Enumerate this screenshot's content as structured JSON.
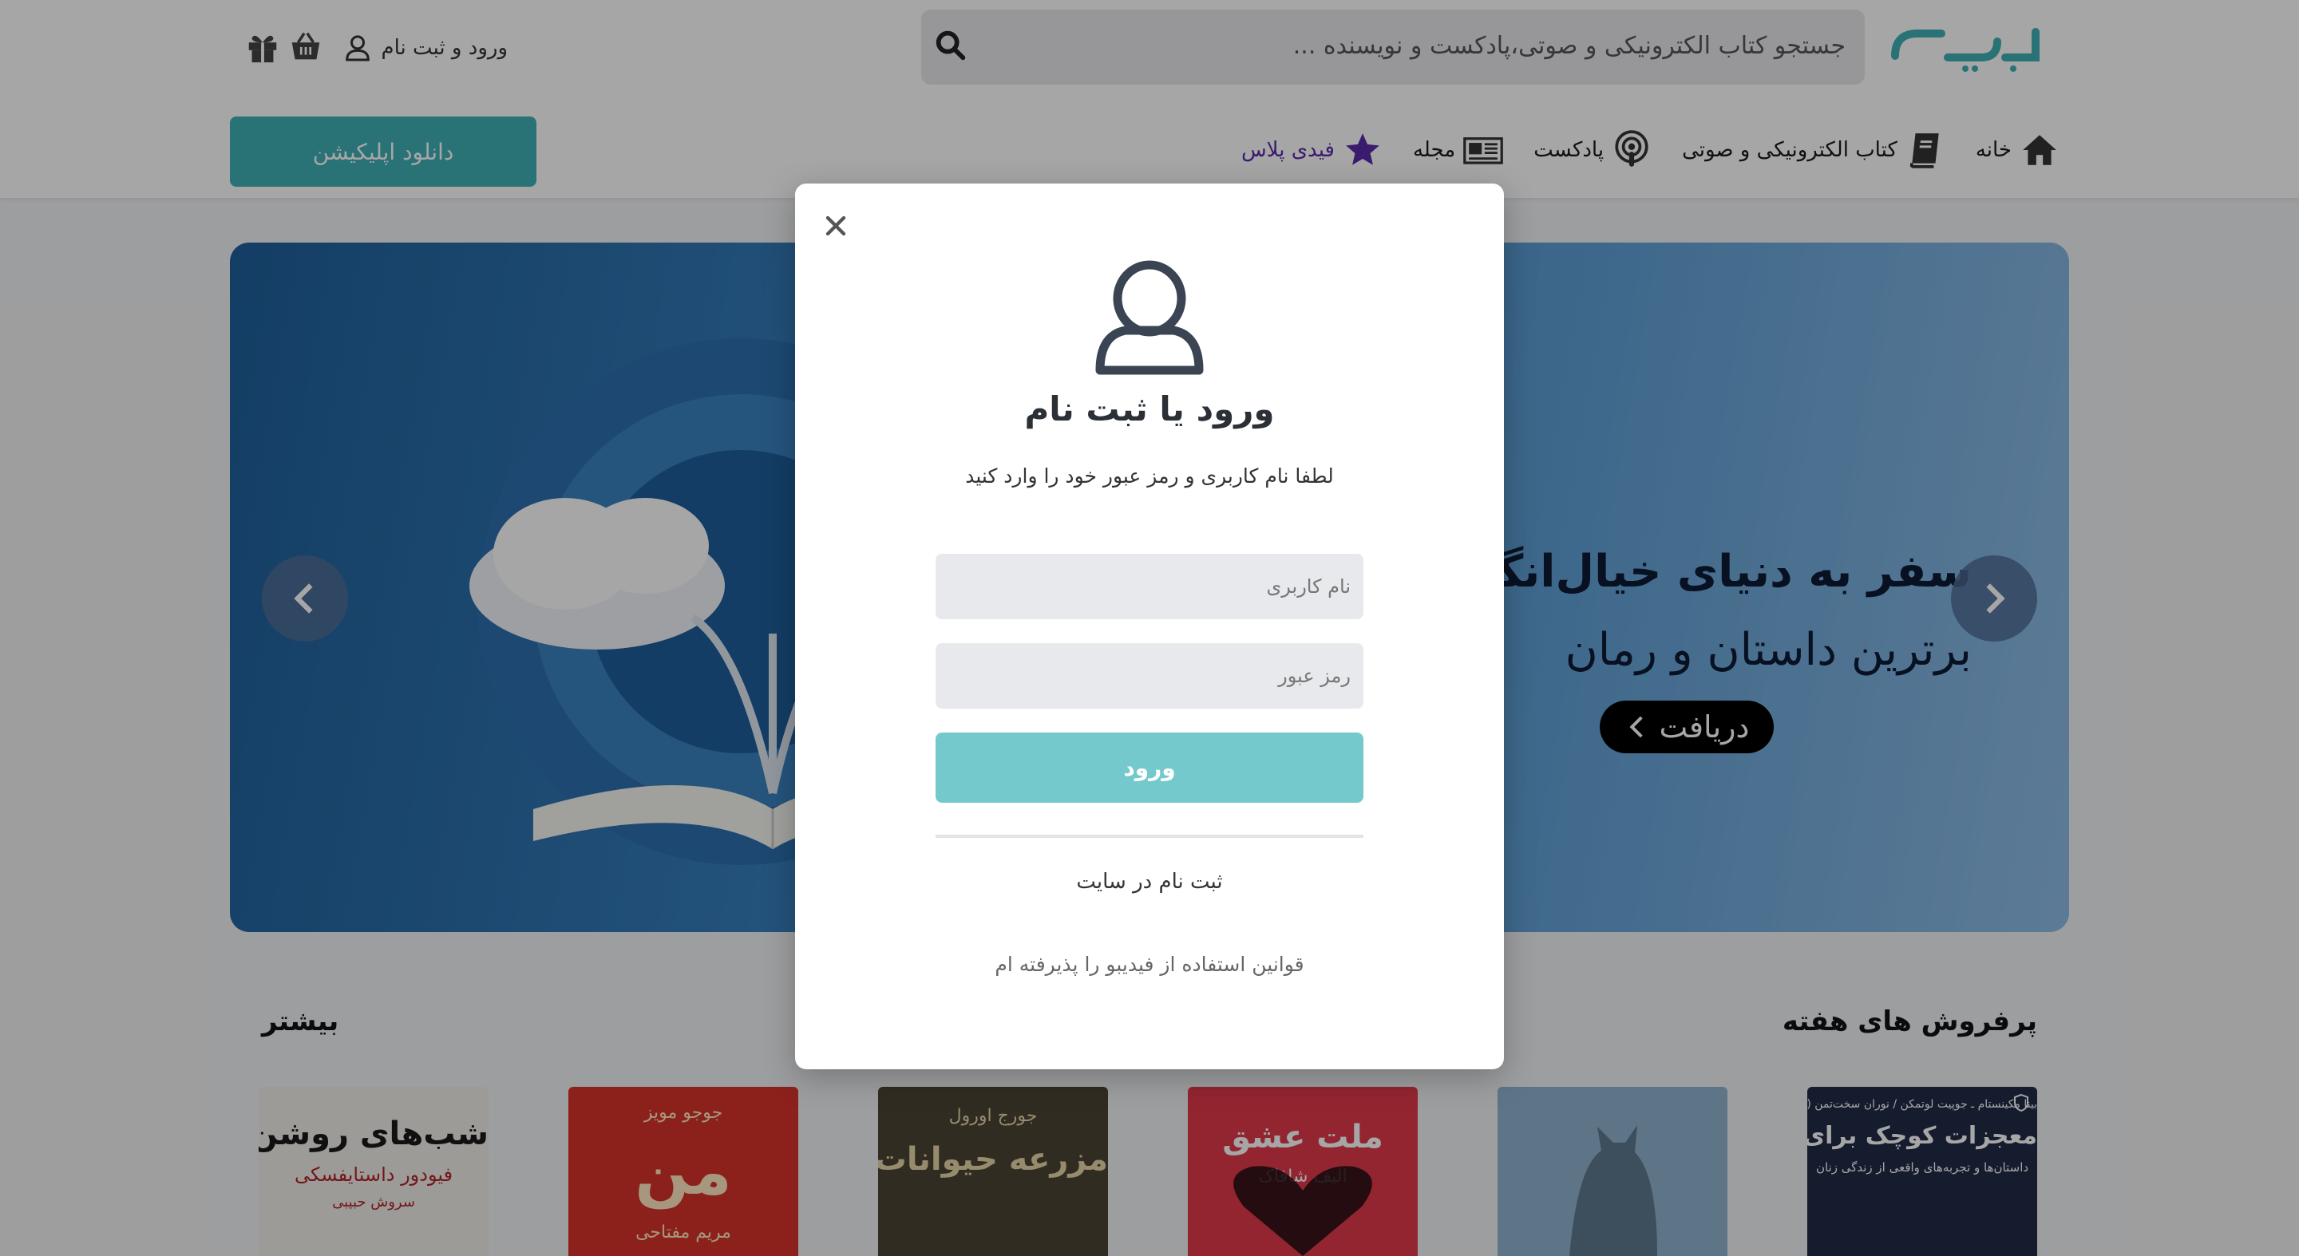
{
  "header": {
    "logo_text": "فیدیبو",
    "search_placeholder": "جستجو کتاب الکترونیکی و صوتی،پادکست و نویسنده ...",
    "login_label": "ورود و ثبت نام",
    "download_app_label": "دانلود اپلیکیشن"
  },
  "nav": {
    "items": [
      {
        "label": "خانه",
        "icon": "home-icon"
      },
      {
        "label": "کتاب الکترونیکی و صوتی",
        "icon": "book-icon"
      },
      {
        "label": "پادکست",
        "icon": "podcast-icon"
      },
      {
        "label": "مجله",
        "icon": "newspaper-icon"
      },
      {
        "label": "فیدی پلاس",
        "icon": "star-icon",
        "color": "#5b2aa8"
      }
    ]
  },
  "banner": {
    "title": "سفر به دنیای خیال‌انگیز قصه‌ها",
    "subtitle": "برترین داستان و رمان",
    "cta": "دریافت"
  },
  "modal": {
    "title": "ورود یا ثبت نام",
    "description": "لطفا نام کاربری و رمز عبور خود را وارد کنید",
    "username_placeholder": "نام کاربری",
    "password_placeholder": "رمز عبور",
    "submit_label": "ورود",
    "register_link": "ثبت نام در سایت",
    "terms_text": "قوانین استفاده از فیدیبو را پذیرفته ام"
  },
  "section": {
    "title": "پرفروش های هفته",
    "more_label": "بیشتر",
    "books": [
      {
        "title": "معجزات کوچک برای زنان",
        "subtitle": "داستان‌ها و تجربه‌های واقعی از زندگی زنان",
        "author_line": "بینا مکینستام ـ جوپیت لوتمکن / نوران سخت‌تمن (مائلی)",
        "bg": "#1f2c48",
        "color": "#ffffff"
      },
      {
        "title": "",
        "subtitle": "",
        "author_line": "",
        "bg": "#8fb4cf",
        "color": "#ffffff"
      },
      {
        "title": "ملت عشق",
        "subtitle": "الیف شافاک",
        "author_line": "",
        "bg": "#e23a4a",
        "color": "#ffffff"
      },
      {
        "title": "مزرعه حیوانات",
        "subtitle": "جورج اورول",
        "author_line": "",
        "bg": "#4c4434",
        "color": "#e8d6a8"
      },
      {
        "title": "من",
        "subtitle": "جوجو مویز",
        "author_line": "مریم مفتاحی",
        "bg": "#d8332b",
        "color": "#ffe9c2"
      },
      {
        "title": "شب‌های روشن",
        "subtitle": "فیودور داستایفسکی",
        "author_line": "سروش حبیبی",
        "bg": "#f1efe9",
        "color": "#1a1a1a"
      }
    ]
  }
}
